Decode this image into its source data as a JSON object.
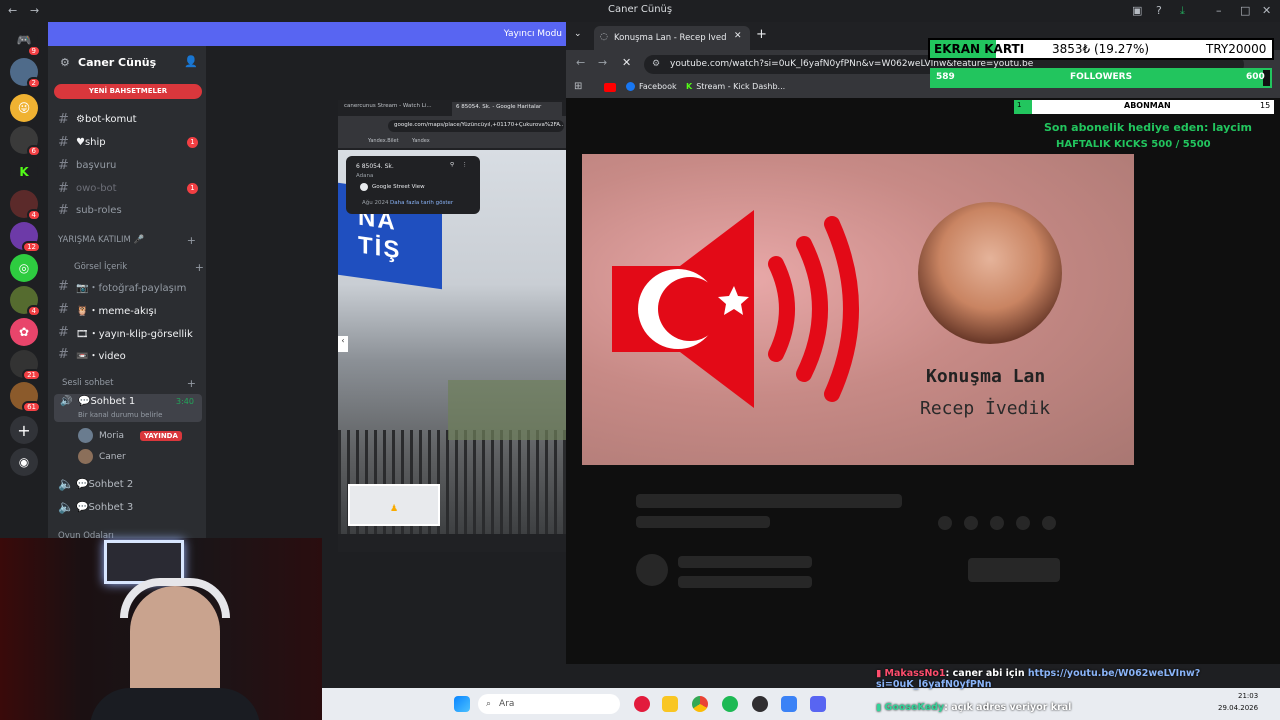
{
  "discord": {
    "window_title": "Caner Cünüş",
    "streamer_banner": "Yayıncı Modu",
    "server_name": "Caner Cünüş",
    "new_mentions": "YENİ BAHSETMELER",
    "rail_badges": [
      "9",
      "2",
      "6",
      "4",
      "12",
      "4",
      "21",
      "61"
    ],
    "channels": [
      {
        "name": "⚙bot-komut",
        "badge": ""
      },
      {
        "name": "♥ship",
        "badge": "1"
      },
      {
        "name": "başvuru",
        "badge": ""
      },
      {
        "name": "owo-bot",
        "badge": "1"
      },
      {
        "name": "sub-roles",
        "badge": ""
      }
    ],
    "categories": {
      "contest": "YARIŞMA KATILIM 🎤",
      "visual": "Görsel İçerik",
      "voice": "Sesli sohbet",
      "games": "Oyun Odaları"
    },
    "visual_channels": [
      "📷・fotoğraf-paylaşım",
      "🦉・meme-akışı",
      "🎞・yayın-klip-görsellik",
      "📼・video"
    ],
    "voice_active": {
      "name": "💬Sohbet 1",
      "time": "3:40",
      "status": "Bir kanal durumu belirle"
    },
    "voice_users": [
      {
        "name": "Moria",
        "live": "YAYINDA"
      },
      {
        "name": "Caner",
        "live": ""
      }
    ],
    "voice_channels": [
      "💬Sohbet 2",
      "💬Sohbet 3"
    ]
  },
  "maps": {
    "tab1": "canercunus Stream - Watch Li...",
    "tab2": "6 85054. Sk. - Google Haritalar",
    "url": "google.com/maps/place/Yüzüncüyıl,+01170+Çukurova%2FA...",
    "bm1": "Yandex.Bilet",
    "bm2": "Yandex",
    "card_title": "6 85054. Sk.",
    "card_sub": "Adana",
    "card_street": "Google Street View",
    "card_date": "Ağu 2024",
    "card_more": "Daha fazla tarih göster",
    "sign": "NA TİŞ"
  },
  "chrome": {
    "tab_title": "Konuşma Lan - Recep İvedik - S",
    "url": "youtube.com/watch?si=0uK_l6yafN0yfPNn&v=W062weLVInw&feature=youtu.be",
    "bookmarks": [
      "Facebook",
      "Stream - Kick Dashb..."
    ],
    "thumb_title": "Konuşma Lan",
    "thumb_sub": "Recep İvedik"
  },
  "overlay": {
    "gpu_label": "EKRAN KARTI",
    "gpu_amount": "3853₺ (19.27%)",
    "gpu_goal": "TRY20000",
    "gpu_progress": 0.1927,
    "followers_current": "589",
    "followers_label": "FOLLOWERS",
    "followers_goal": "600",
    "followers_progress": 0.98,
    "subs_current": "1",
    "subs_label": "ABONMAN",
    "subs_goal": "15",
    "subs_progress": 0.07,
    "gift_text": "Son abonelik hediye eden: laycim",
    "kicks_text": "HAFTALIK KICKS 500 / 5500"
  },
  "chat": [
    {
      "user": "MakassNo1",
      "msg": ": caner abi için ",
      "link": "https://youtu.be/W062weLVInw?si=0uK_l6yafN0yfPNn",
      "color": "#ff4d6d"
    },
    {
      "user": "GooseKedy",
      "msg": ": açık adres veriyor kral",
      "link": "",
      "color": "#34d399"
    }
  ],
  "taskbar": {
    "search": "Ara",
    "time": "21:03",
    "date": "29.04.2026"
  },
  "colors": {
    "discord_blurple": "#5865f2",
    "overlay_green": "#22c55e",
    "alert_red": "#da373c"
  }
}
